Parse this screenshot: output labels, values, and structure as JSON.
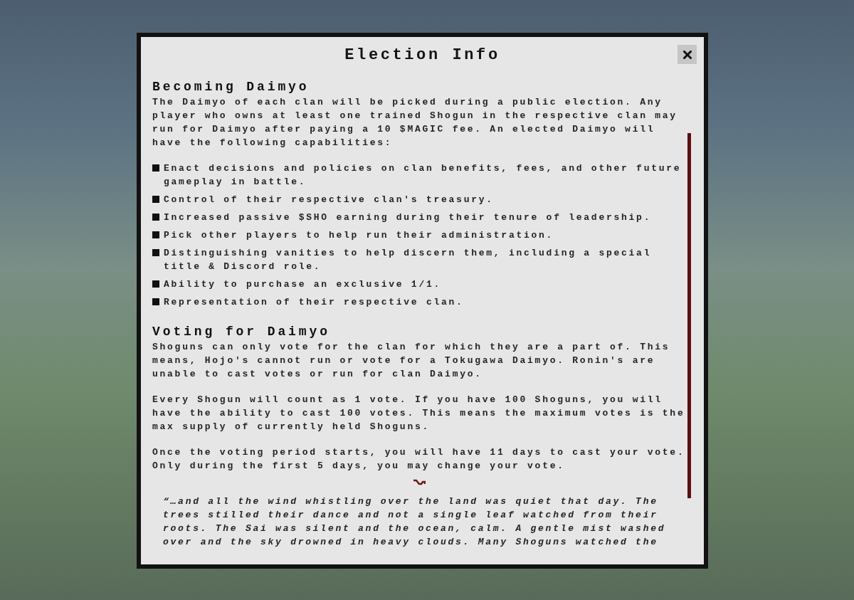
{
  "dialog": {
    "title": "Election Info"
  },
  "sections": [
    {
      "heading": "Becoming Daimyo",
      "blocks": [
        {
          "kind": "paragraph",
          "text": "The Daimyo of each clan will be picked during a public election. Any player who owns at least one trained Shogun in the respective clan may run for Daimyo after paying a 10 $MAGIC fee. An elected Daimyo will have the following capabilities:"
        },
        {
          "kind": "list",
          "items": [
            "Enact decisions and policies on clan benefits, fees, and other future gameplay in battle.",
            "Control of their respective clan's treasury.",
            "Increased passive $SHO earning during their tenure of leadership.",
            "Pick other players to help run their administration.",
            "Distinguishing vanities to help discern them, including a special title & Discord role.",
            "Ability to purchase an exclusive 1/1.",
            "Representation of their respective clan."
          ]
        }
      ]
    },
    {
      "heading": "Voting for Daimyo",
      "blocks": [
        {
          "kind": "paragraph",
          "text": "Shoguns can only vote for the clan for which they are a part of. This means, Hojo's cannot run or vote for a Tokugawa Daimyo. Ronin's are unable to cast votes or run for clan Daimyo."
        },
        {
          "kind": "paragraph",
          "text": "Every Shogun will count as 1 vote. If you have 100 Shoguns, you will have the ability to cast 100 votes. This means the maximum votes is the max supply of currently held Shoguns."
        },
        {
          "kind": "paragraph",
          "text": "Once the voting period starts, you will have 11 days to cast your vote. Only during the first 5 days, you may change your vote."
        }
      ]
    }
  ],
  "quote": {
    "text": "**“**…and all the wind whistling over the land was quiet that day. The trees stilled their dance and not a single leaf watched from their roots. The Sai was silent and the ocean, calm. A gentle mist washed over and the sky drowned in heavy clouds. Many Shoguns watched the"
  }
}
